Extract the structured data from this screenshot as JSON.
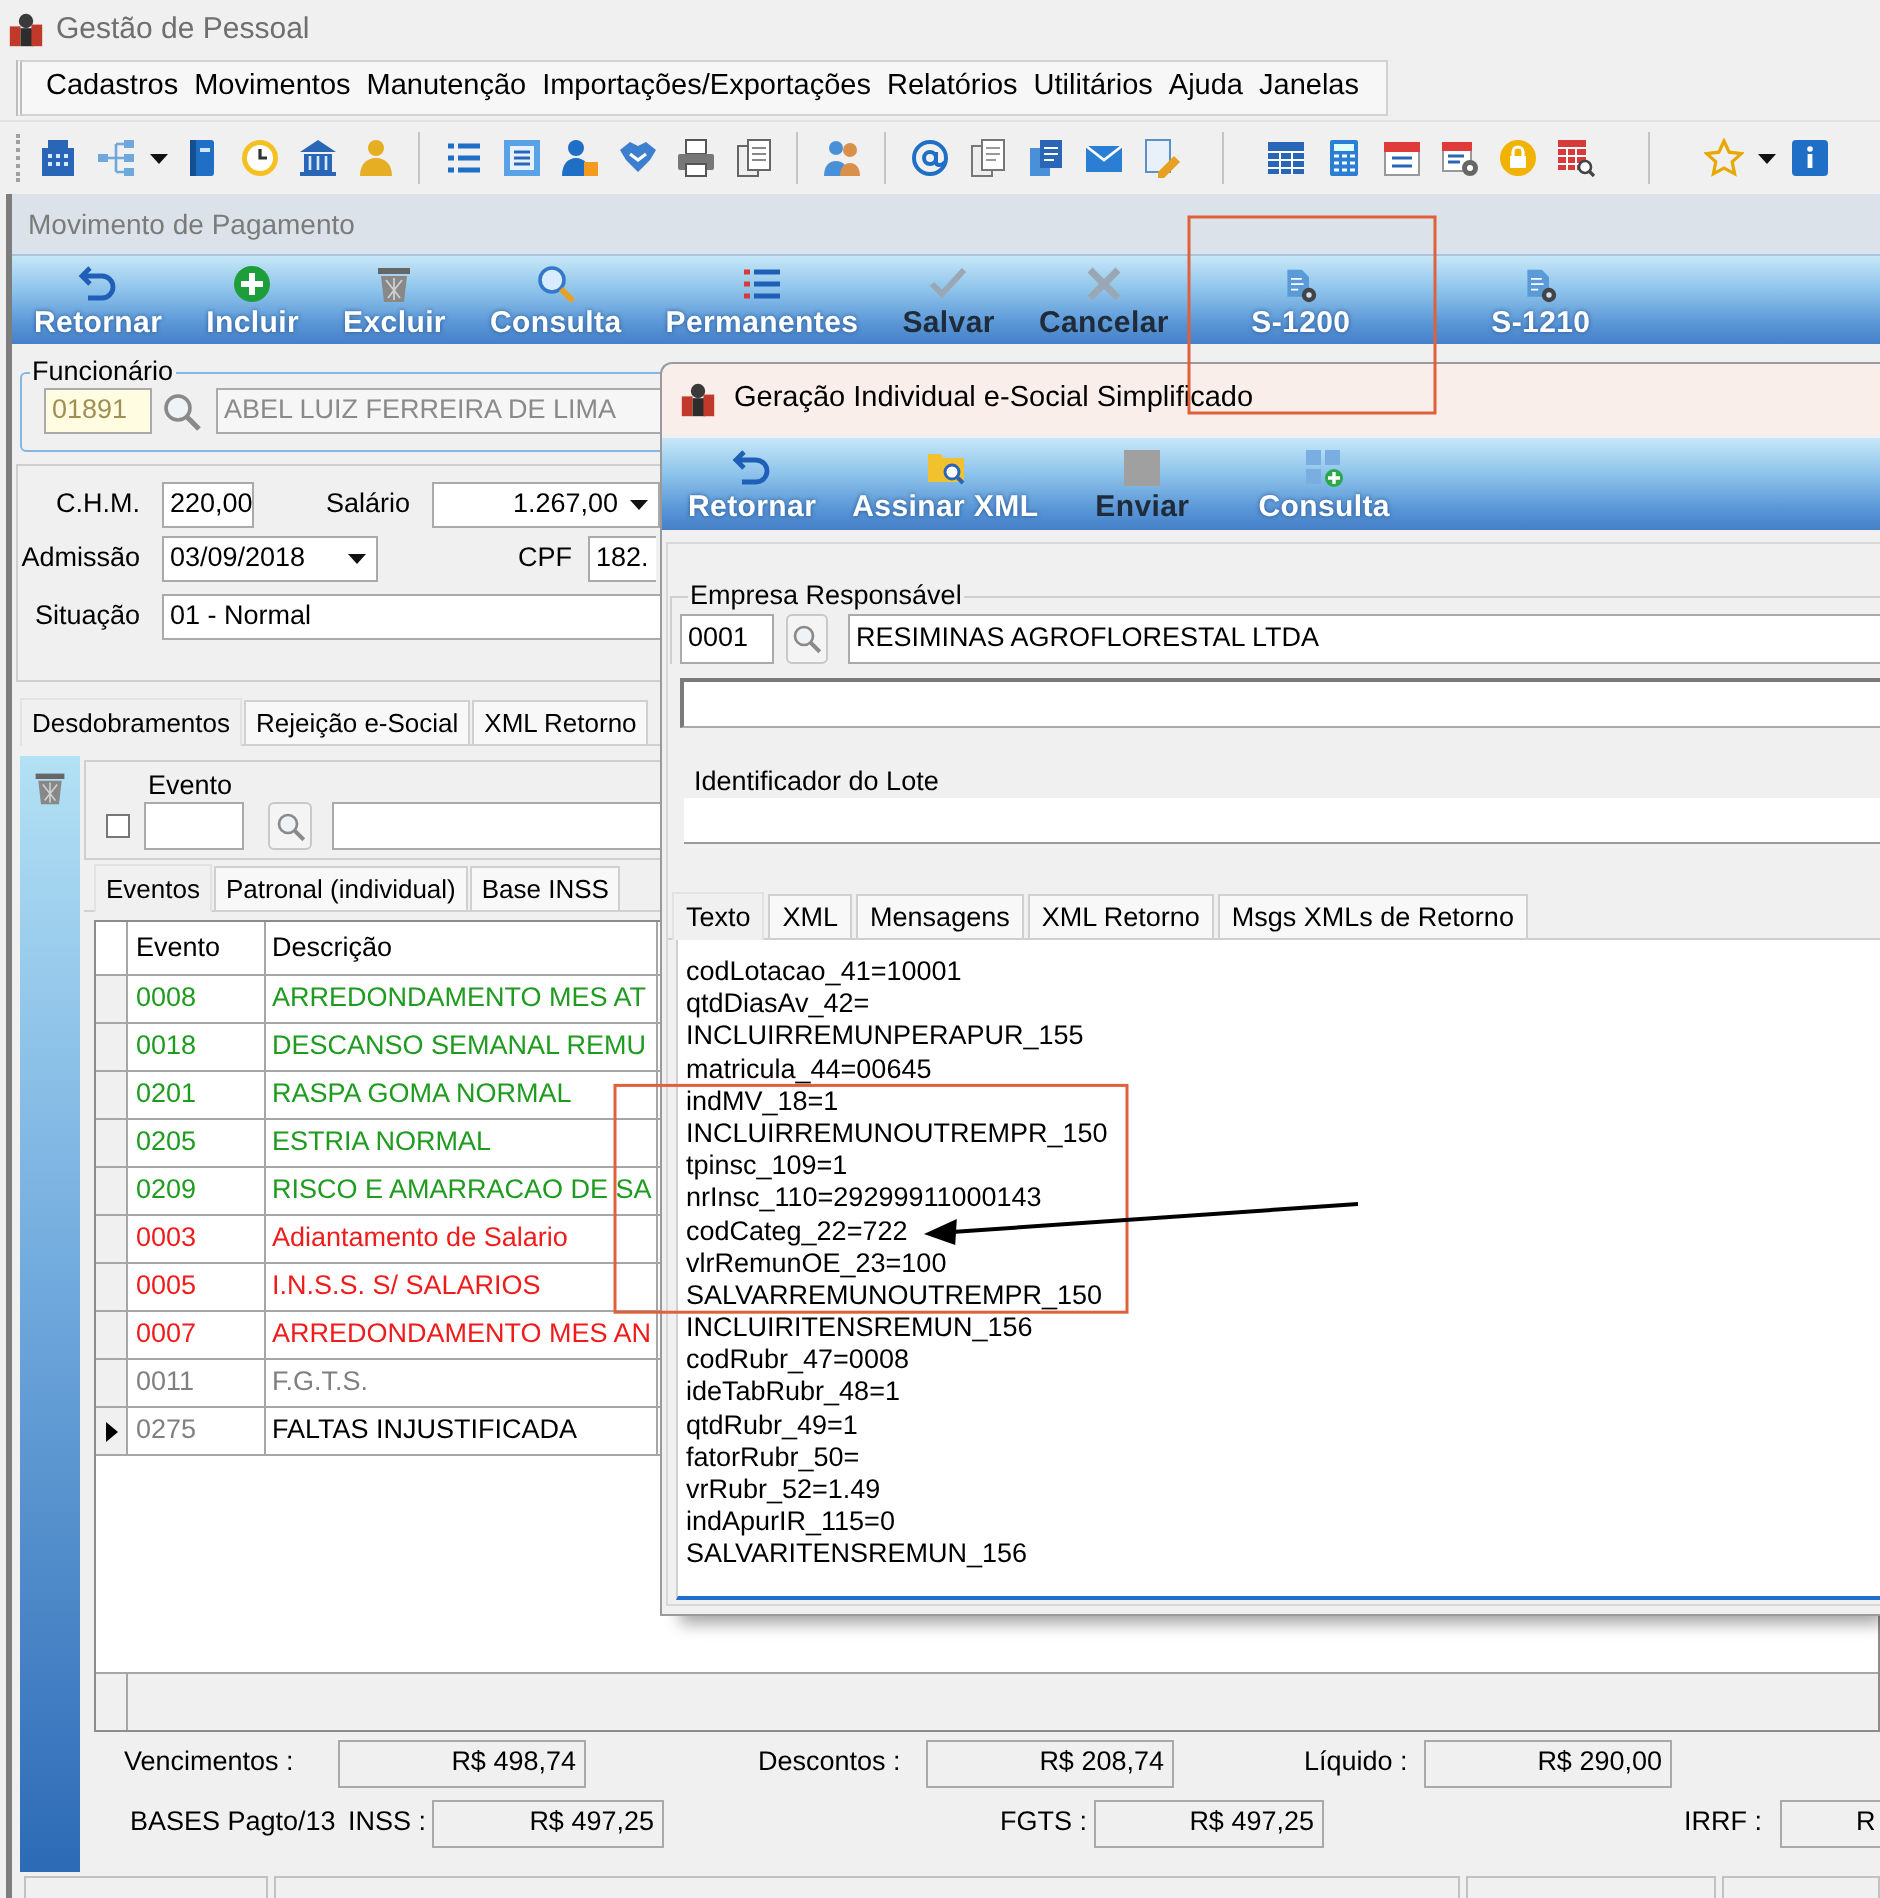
{
  "app": {
    "title": "Gestão de Pessoal",
    "menu": [
      "Cadastros",
      "Movimentos",
      "Manutenção",
      "Importações/Exportações",
      "Relatórios",
      "Utilitários",
      "Ajuda",
      "Janelas"
    ]
  },
  "payment_window": {
    "title": "Movimento de Pagamento",
    "toolbar": [
      {
        "label": "Retornar",
        "disabled": false
      },
      {
        "label": "Incluir",
        "disabled": false
      },
      {
        "label": "Excluir",
        "disabled": false
      },
      {
        "label": "Consulta",
        "disabled": false
      },
      {
        "label": "Permanentes",
        "disabled": false
      },
      {
        "label": "Salvar",
        "disabled": true
      },
      {
        "label": "Cancelar",
        "disabled": true
      },
      {
        "label": "S-1200",
        "disabled": false
      },
      {
        "label": "S-1210",
        "disabled": false
      }
    ],
    "employee": {
      "label": "Funcionário",
      "code": "01891",
      "name": "ABEL LUIZ FERREIRA DE LIMA",
      "disabled": true
    },
    "form": {
      "chm": {
        "label": "C.H.M.",
        "value": "220,00"
      },
      "salary": {
        "label": "Salário",
        "value": "1.267,00"
      },
      "admission": {
        "label": "Admissão",
        "value": "03/09/2018"
      },
      "cpf": {
        "label": "CPF",
        "value": "182."
      },
      "situation": {
        "label": "Situação",
        "value": "01 - Normal"
      }
    },
    "tabs": [
      {
        "label": "Desdobramentos",
        "selected": true
      },
      {
        "label": "Rejeição e-Social",
        "selected": false
      },
      {
        "label": "XML Retorno",
        "selected": false
      }
    ],
    "filter": {
      "label": "Evento",
      "checked": false
    },
    "event_tabs": [
      {
        "label": "Eventos",
        "selected": true
      },
      {
        "label": "Patronal (individual)",
        "selected": false
      },
      {
        "label": "Base INSS",
        "selected": false
      }
    ],
    "table": {
      "columns": [
        "Evento",
        "Descrição"
      ],
      "rows": [
        {
          "code": "0008",
          "description": "ARREDONDAMENTO MES AT",
          "color": "#1f9c1f",
          "selected": false
        },
        {
          "code": "0018",
          "description": "DESCANSO SEMANAL REMU",
          "color": "#1f9c1f",
          "selected": false
        },
        {
          "code": "0201",
          "description": "RASPA GOMA NORMAL",
          "color": "#1f9c1f",
          "selected": false
        },
        {
          "code": "0205",
          "description": "ESTRIA NORMAL",
          "color": "#1f9c1f",
          "selected": false
        },
        {
          "code": "0209",
          "description": "RISCO E AMARRACAO DE SA",
          "color": "#1f9c1f",
          "selected": false
        },
        {
          "code": "0003",
          "description": "Adiantamento de Salario",
          "color": "#f01c1c",
          "selected": false
        },
        {
          "code": "0005",
          "description": "I.N.S.S. S/ SALARIOS",
          "color": "#f01c1c",
          "selected": false
        },
        {
          "code": "0007",
          "description": "ARREDONDAMENTO MES AN",
          "color": "#f01c1c",
          "selected": false
        },
        {
          "code": "0011",
          "description": "F.G.T.S.",
          "color": "#808080",
          "selected": false
        },
        {
          "code": "0275",
          "description": "FALTAS INJUSTIFICADA",
          "color": "#808080",
          "selected": true
        }
      ]
    },
    "totals": [
      {
        "label": "Vencimentos :",
        "value": "R$ 498,74"
      },
      {
        "label": "Descontos :",
        "value": "R$ 208,74"
      },
      {
        "label": "Líquido :",
        "value": "R$ 290,00"
      }
    ],
    "bases": {
      "label": "BASES Pagto/13",
      "items": [
        {
          "label": "INSS :",
          "value": "R$ 497,25"
        },
        {
          "label": "FGTS :",
          "value": "R$ 497,25"
        },
        {
          "label": "IRRF :",
          "value": "R"
        }
      ]
    }
  },
  "dialog": {
    "title": "Geração Individual e-Social Simplificado",
    "toolbar": [
      {
        "label": "Retornar",
        "disabled": false
      },
      {
        "label": "Assinar XML",
        "disabled": false
      },
      {
        "label": "Enviar",
        "disabled": true
      },
      {
        "label": "Consulta",
        "disabled": false
      }
    ],
    "company": {
      "label": "Empresa Responsável",
      "code": "0001",
      "name": "RESIMINAS AGROFLORESTAL LTDA"
    },
    "batch": {
      "label": "Identificador do Lote"
    },
    "tabs": [
      {
        "label": "Texto",
        "selected": true
      },
      {
        "label": "XML",
        "selected": false
      },
      {
        "label": "Mensagens",
        "selected": false
      },
      {
        "label": "XML Retorno",
        "selected": false
      },
      {
        "label": "Msgs XMLs de Retorno",
        "selected": false
      }
    ],
    "lines": [
      "codLotacao_41=10001",
      "qtdDiasAv_42=",
      "INCLUIRREMUNPERAPUR_155",
      "matricula_44=00645",
      "indMV_18=1",
      "INCLUIRREMUNOUTREMPR_150",
      "tpinsc_109=1",
      "nrInsc_110=29299911000143",
      "codCateg_22=722",
      "vlrRemunOE_23=100",
      "SALVARREMUNOUTREMPR_150",
      "INCLUIRITENSREMUN_156",
      "codRubr_47=0008",
      "ideTabRubr_48=1",
      "qtdRubr_49=1",
      "fatorRubr_50=",
      "vrRubr_52=1.49",
      "indApurIR_115=0",
      "SALVARITENSREMUN_156"
    ]
  }
}
